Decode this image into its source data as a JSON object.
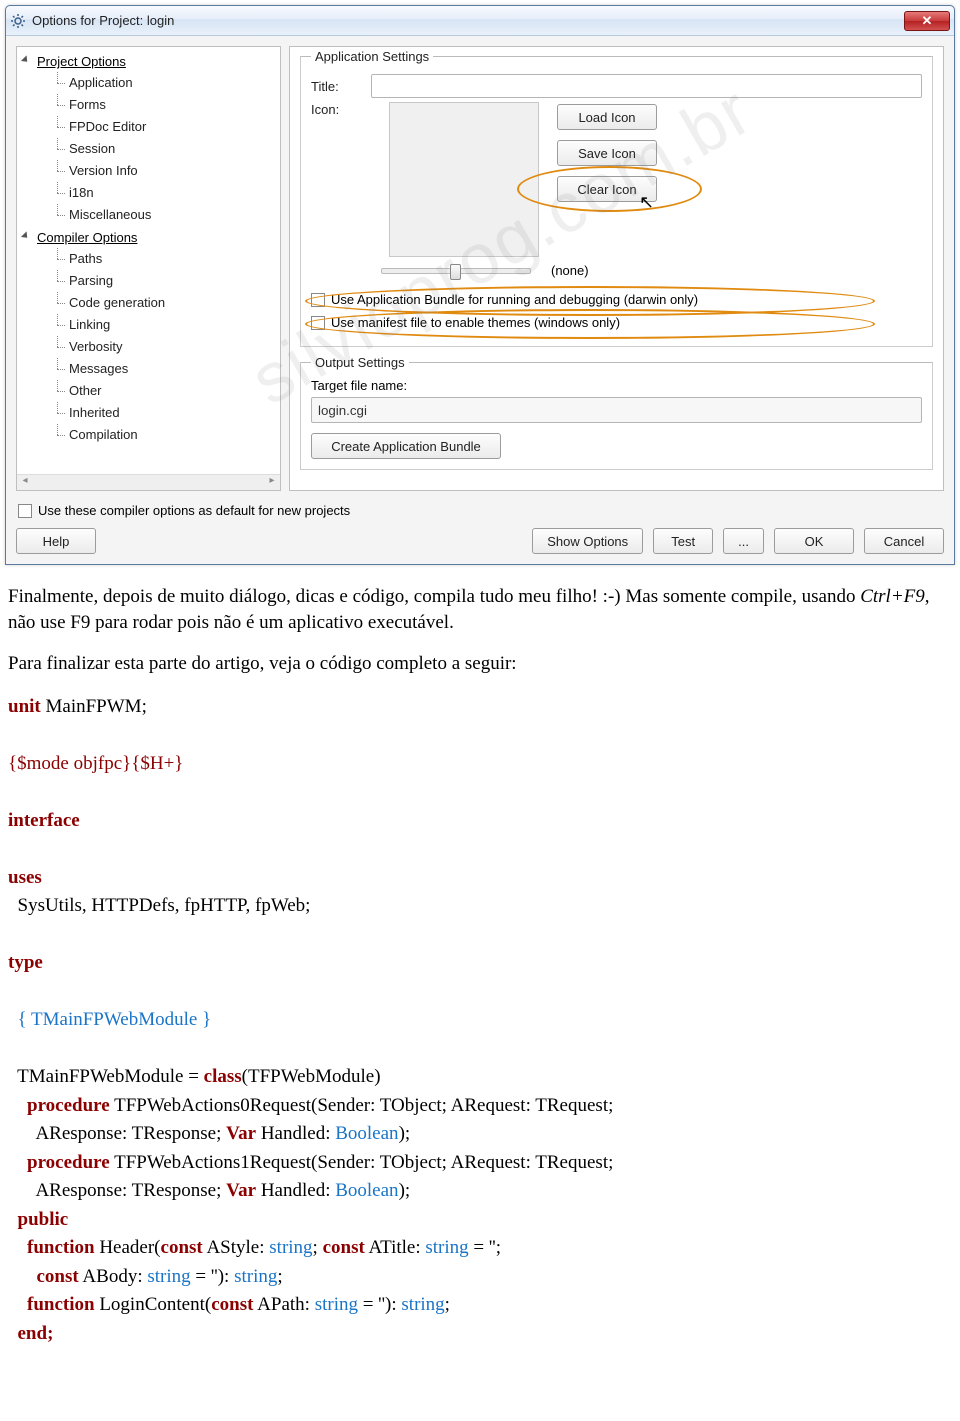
{
  "window": {
    "title": "Options for Project: login",
    "closeGlyph": "✕"
  },
  "tree": {
    "group1": "Project Options",
    "g1items": [
      "Application",
      "Forms",
      "FPDoc Editor",
      "Session",
      "Version Info",
      "i18n",
      "Miscellaneous"
    ],
    "group2": "Compiler Options",
    "g2items": [
      "Paths",
      "Parsing",
      "Code generation",
      "Linking",
      "Verbosity",
      "Messages",
      "Other",
      "Inherited",
      "Compilation"
    ]
  },
  "appSettings": {
    "legend": "Application Settings",
    "titleLabel": "Title:",
    "iconLabel": "Icon:",
    "loadIcon": "Load Icon",
    "saveIcon": "Save Icon",
    "clearIcon": "Clear Icon",
    "noneLabel": "(none)",
    "chk1": "Use Application Bundle for running and debugging (darwin only)",
    "chk2": "Use manifest file to enable themes (windows only)"
  },
  "outputSettings": {
    "legend": "Output Settings",
    "targetLabel": "Target file name:",
    "targetValue": "login.cgi",
    "createBundle": "Create Application Bundle"
  },
  "footer": {
    "defaultChk": "Use these compiler options as default for new projects",
    "help": "Help",
    "showOptions": "Show Options",
    "test": "Test",
    "dots": "...",
    "ok": "OK",
    "cancel": "Cancel"
  },
  "watermark": "silvioprog.com.br",
  "article": {
    "p1a": "Finalmente, depois de muito diálogo, dicas e código, compila tudo meu filho! :-) Mas somente compile, usando ",
    "p1i": "Ctrl+F9",
    "p1b": ", não use F9 para rodar pois não é um aplicativo executável.",
    "p2": "Para finalizar esta parte do artigo, veja o código completo a seguir:"
  },
  "code": {
    "l1_kw": "unit",
    "l1_nm": " MainFPWM;",
    "l2": "{$mode objfpc}{$H+}",
    "l3": "interface",
    "l4": "uses",
    "l5": "  SysUtils, HTTPDefs, fpHTTP, fpWeb;",
    "l6": "type",
    "l7": "  { TMainFPWebModule }",
    "l8a": "  TMainFPWebModule = ",
    "l8kw": "class",
    "l8b": "(TFPWebModule)",
    "l9kw": "    procedure",
    "l9": " TFPWebActions0Request(Sender: TObject; ARequest: TRequest;",
    "l10": "      AResponse: TResponse; ",
    "l10v": "Var",
    "l10b": " Handled: ",
    "l10t": "Boolean",
    "l10e": ");",
    "l11kw": "    procedure",
    "l11": " TFPWebActions1Request(Sender: TObject; ARequest: TRequest;",
    "l12": "      AResponse: TResponse; ",
    "l12v": "Var",
    "l12b": " Handled: ",
    "l12t": "Boolean",
    "l12e": ");",
    "l13": "  public",
    "l14kw": "    function",
    "l14": " Header(",
    "l14c1": "const",
    "l14a": " AStyle: ",
    "l14t1": "string",
    "l14s": "; ",
    "l14c2": "const",
    "l14b": " ATitle: ",
    "l14t2": "string",
    "l14eq": " = '';",
    "l15c": "      const",
    "l15": " ABody: ",
    "l15t": "string",
    "l15eq": " = ''): ",
    "l15rt": "string",
    "l15e": ";",
    "l16kw": "    function",
    "l16": " LoginContent(",
    "l16c": "const",
    "l16a": " APath: ",
    "l16t": "string",
    "l16eq": " = ''): ",
    "l16rt": "string",
    "l16e": ";",
    "l17": "  end;"
  }
}
